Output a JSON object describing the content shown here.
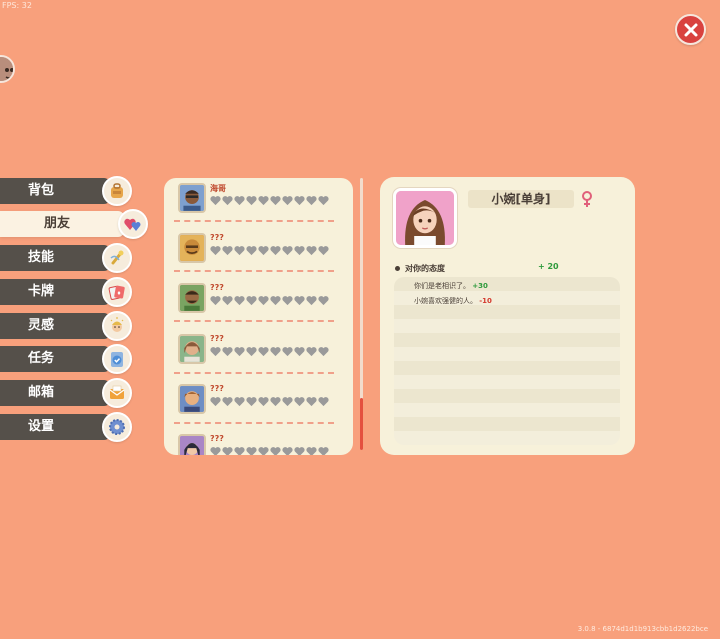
{
  "fps": "FPS: 32",
  "version": "3.0.8 - 6874d1d1b913cbb1d2622bce",
  "menu": [
    {
      "label": "背包",
      "icon": "backpack-icon"
    },
    {
      "label": "朋友",
      "icon": "hearts-icon",
      "active": true
    },
    {
      "label": "技能",
      "icon": "skill-icon"
    },
    {
      "label": "卡牌",
      "icon": "cards-icon"
    },
    {
      "label": "灵感",
      "icon": "inspiration-icon"
    },
    {
      "label": "任务",
      "icon": "task-icon"
    },
    {
      "label": "邮箱",
      "icon": "mail-icon"
    },
    {
      "label": "设置",
      "icon": "settings-icon"
    }
  ],
  "friends": [
    {
      "name": "海哥",
      "hearts_filled": 0
    },
    {
      "name": "???",
      "hearts_filled": 0
    },
    {
      "name": "???",
      "hearts_filled": 0
    },
    {
      "name": "???",
      "hearts_filled": 0
    },
    {
      "name": "???",
      "hearts_filled": 0
    },
    {
      "name": "???",
      "hearts_filled": 0
    }
  ],
  "detail": {
    "name": "小婉[单身]",
    "gender_icon": "female-symbol-icon",
    "attitude_label": "对你的态度",
    "attitude_value": "+ 20",
    "reasons": [
      {
        "text": "你们是老相识了。",
        "delta": "+30",
        "positive": true
      },
      {
        "text": "小婉喜欢强健的人。",
        "delta": "-10",
        "positive": false
      }
    ]
  },
  "colors": {
    "background": "#f8a07c",
    "panel": "#f7f1da",
    "accent_red": "#d9423f",
    "positive": "#2e9a3c",
    "negative": "#d43a2e"
  }
}
